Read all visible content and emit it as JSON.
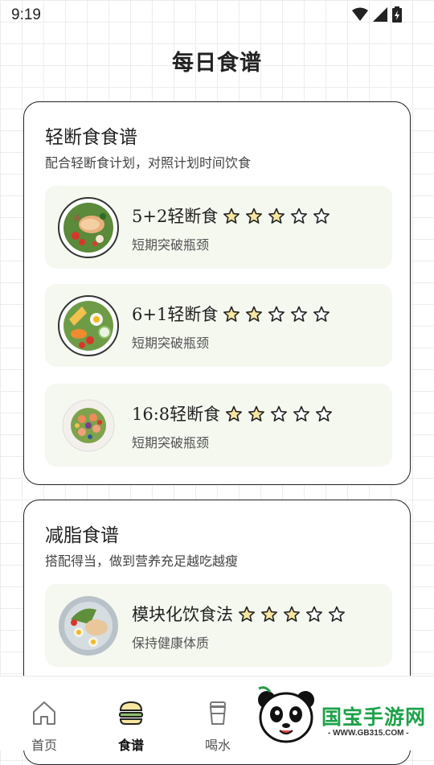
{
  "status_bar": {
    "time": "9:19",
    "icons": [
      "wifi-icon",
      "signal-icon",
      "battery-icon"
    ]
  },
  "page": {
    "title": "每日食谱"
  },
  "sections": [
    {
      "title": "轻断食食谱",
      "subtitle": "配合轻断食计划，对照计划时间饮食",
      "recipes": [
        {
          "name": "5+2轻断食",
          "desc": "短期突破瓶颈",
          "rating": 3,
          "max_rating": 5
        },
        {
          "name": "6+1轻断食",
          "desc": "短期突破瓶颈",
          "rating": 2,
          "max_rating": 5
        },
        {
          "name": "16:8轻断食",
          "desc": "短期突破瓶颈",
          "rating": 2,
          "max_rating": 5
        }
      ]
    },
    {
      "title": "减脂食谱",
      "subtitle": "搭配得当，做到营养充足越吃越瘦",
      "recipes": [
        {
          "name": "模块化饮食法",
          "desc": "保持健康体质",
          "rating": 3,
          "max_rating": 5
        }
      ]
    }
  ],
  "bottom_nav": [
    {
      "label": "首页",
      "icon": "home-icon",
      "active": false
    },
    {
      "label": "食谱",
      "icon": "burger-icon",
      "active": true
    },
    {
      "label": "喝水",
      "icon": "cup-icon",
      "active": false
    }
  ],
  "watermark": {
    "title": "国宝手游网",
    "url": "- WWW.GB315.COM -"
  },
  "colors": {
    "star_fill": "#f6e6a0",
    "star_stroke": "#222222",
    "recipe_bg": "#f5f8ef",
    "card_border": "#222222"
  }
}
